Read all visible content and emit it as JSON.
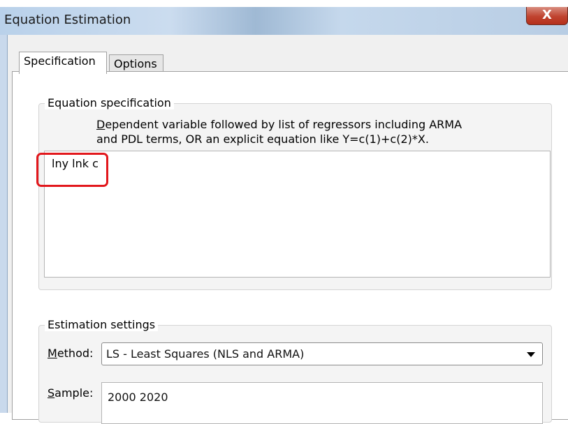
{
  "window": {
    "title": "Equation Estimation",
    "close_label": "X"
  },
  "tabs": [
    {
      "label": "Specification",
      "active": true
    },
    {
      "label": "Options",
      "active": false
    }
  ],
  "equation_spec": {
    "group_label": "Equation specification",
    "desc_line1_underlined": "D",
    "desc_line1_rest": "ependent variable followed by list of regressors including ARMA",
    "desc_line2": "and PDL terms, OR an explicit equation like Y=c(1)+c(2)*X.",
    "value": "lny lnk c"
  },
  "estimation_settings": {
    "group_label": "Estimation settings",
    "method_label_underlined": "M",
    "method_label_rest": "ethod:",
    "method_value": "LS  -  Least Squares (NLS and ARMA)",
    "sample_label_underlined": "S",
    "sample_label_rest": "ample:",
    "sample_value": "2000 2020"
  },
  "colors": {
    "highlight": "#e2171c",
    "close_button": "#c0432f"
  }
}
